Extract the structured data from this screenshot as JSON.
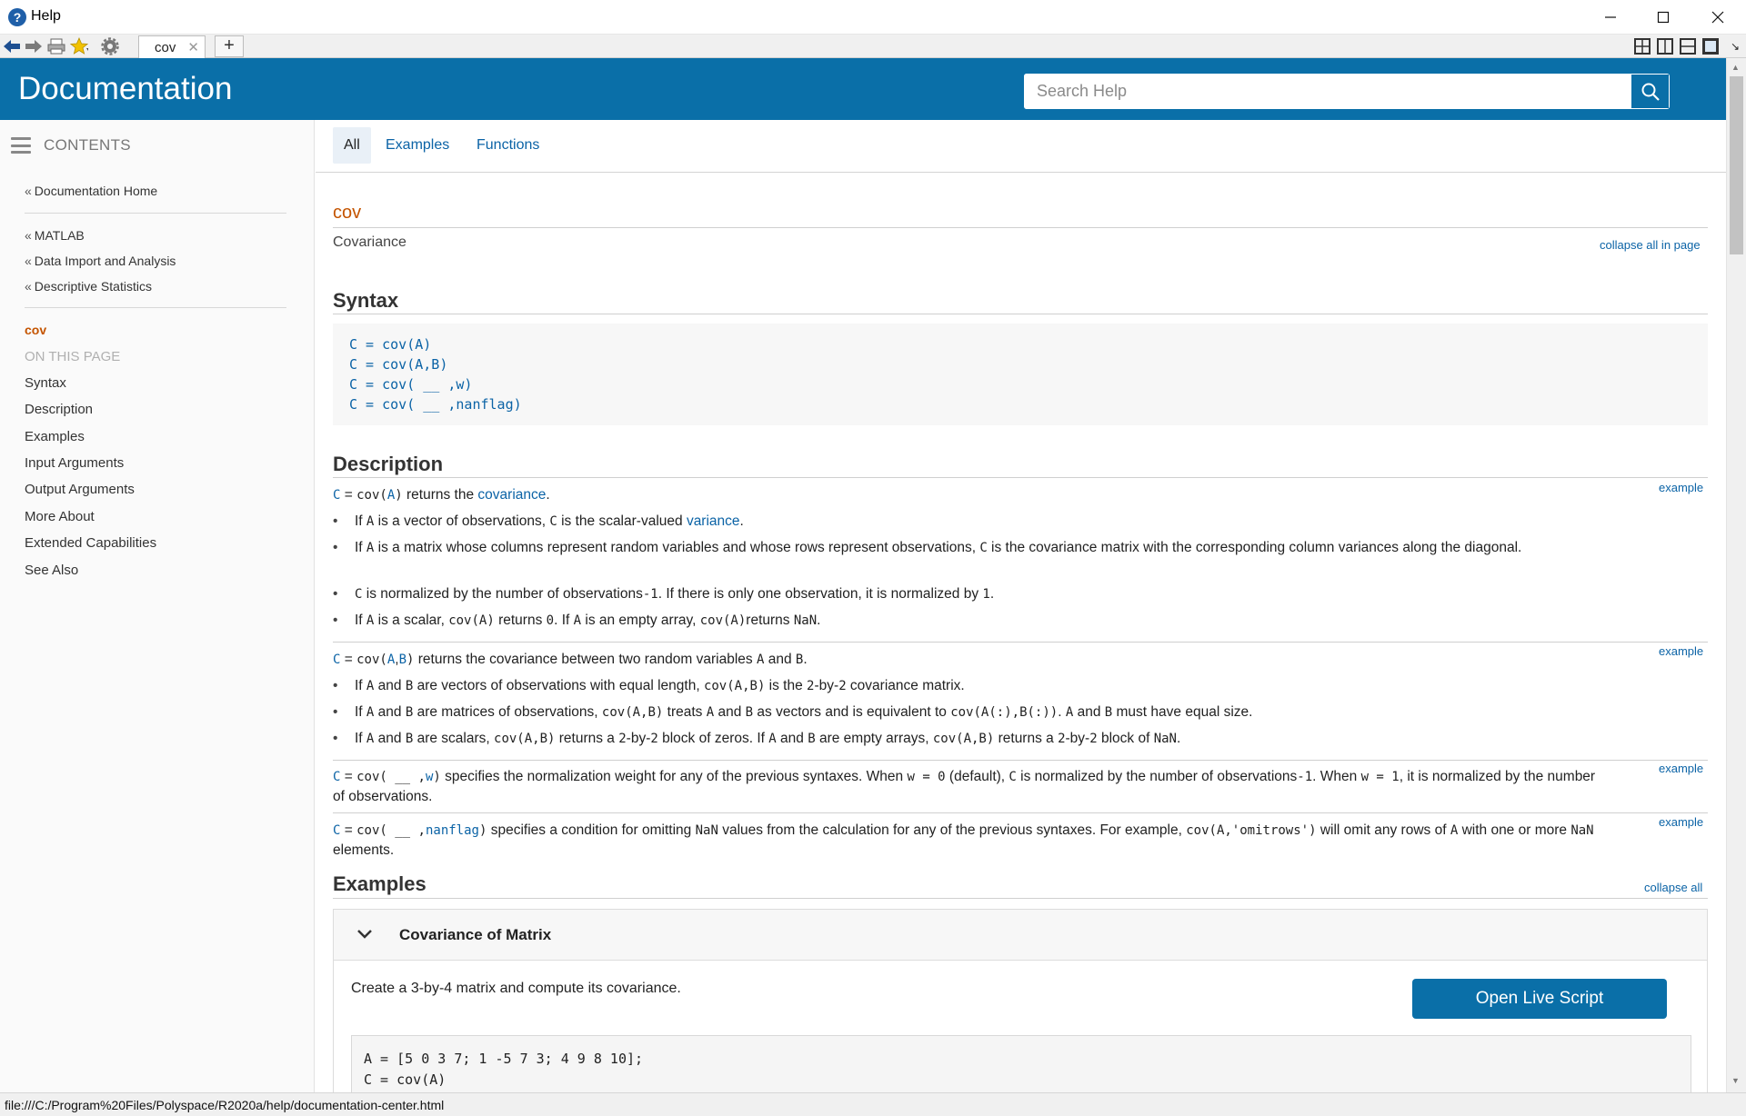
{
  "window": {
    "title": "Help",
    "icon_letter": "?"
  },
  "toolbar": {
    "tab_label": "cov",
    "new_tab": "+"
  },
  "header": {
    "title": "Documentation",
    "search_placeholder": "Search Help"
  },
  "sidebar": {
    "contents_label": "CONTENTS",
    "home_link": "Documentation Home",
    "crumbs": [
      "MATLAB",
      "Data Import and Analysis",
      "Descriptive Statistics"
    ],
    "current": "cov",
    "on_this_page": "ON THIS PAGE",
    "items": [
      "Syntax",
      "Description",
      "Examples",
      "Input Arguments",
      "Output Arguments",
      "More About",
      "Extended Capabilities",
      "See Also"
    ]
  },
  "tabs": [
    "All",
    "Examples",
    "Functions"
  ],
  "page": {
    "ref_title": "cov",
    "purpose": "Covariance",
    "collapse_all_in_page": "collapse all in page",
    "syntax_heading": "Syntax",
    "syntax": [
      "C = cov(A)",
      "C = cov(A,B)",
      "C = cov( __ ,w)",
      "C = cov( __ ,nanflag)"
    ],
    "description_heading": "Description",
    "example_link": "example",
    "examples_heading": "Examples",
    "collapse_all": "collapse all",
    "example_title": "Covariance of Matrix",
    "example_desc": "Create a 3-by-4 matrix and compute its covariance.",
    "open_live_script": "Open Live Script",
    "example_code": [
      "A = [5 0 3 7; 1 -5 7 3; 4 9 8 10];",
      "C = cov(A)"
    ]
  },
  "statusbar": {
    "url": "file:///C:/Program%20Files/Polyspace/R2020a/help/documentation-center.html"
  },
  "colors": {
    "brand": "#0a6fa8",
    "ref_title": "#c45400",
    "link": "#0b63a6"
  }
}
